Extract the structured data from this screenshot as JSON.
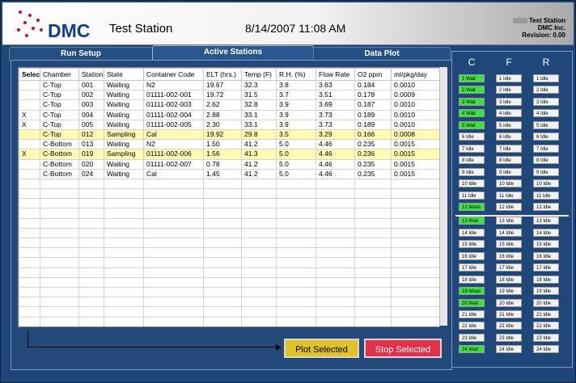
{
  "header": {
    "logo_text": "DMC",
    "app_title": "Test Station",
    "datetime": "8/14/2007   11:08 AM",
    "info_lines": [
      "Test Station",
      "DMC Inc.",
      "Revision: 0.00"
    ]
  },
  "tabs": [
    {
      "label": "Run Setup",
      "active": false
    },
    {
      "label": "Active Stations",
      "active": true
    },
    {
      "label": "Data Plot",
      "active": false
    }
  ],
  "table": {
    "columns": [
      "Select",
      "Chamber",
      "Station",
      "State",
      "Container Code",
      "ELT (hrs.)",
      "Temp (F)",
      "R.H. (%)",
      "Flow Rate",
      "O2 ppm",
      "ml/pkg/day"
    ],
    "rows": [
      {
        "cells": [
          "",
          "C-Top",
          "001",
          "Waiting",
          "N2",
          "19.67",
          "32.3",
          "3.8",
          "3.63",
          "0.184",
          "0.0010"
        ],
        "highlight": false
      },
      {
        "cells": [
          "",
          "C-Top",
          "002",
          "Waiting",
          "01111-002-001",
          "19.72",
          "31.5",
          "3.7",
          "3.51",
          "0.178",
          "0.0009"
        ],
        "highlight": false
      },
      {
        "cells": [
          "",
          "C-Top",
          "003",
          "Waiting",
          "01111-002-003",
          "2.62",
          "32.8",
          "3.9",
          "3.69",
          "0.187",
          "0.0010"
        ],
        "highlight": false
      },
      {
        "cells": [
          "X",
          "C-Top",
          "004",
          "Waiting",
          "01111-002-004",
          "2.88",
          "33.1",
          "3.9",
          "3.73",
          "0.189",
          "0.0010"
        ],
        "highlight": false
      },
      {
        "cells": [
          "X",
          "C-Top",
          "005",
          "Waiting",
          "01111-002-005",
          "2.30",
          "33.1",
          "3.9",
          "3.73",
          "0.189",
          "0.0010"
        ],
        "highlight": false
      },
      {
        "cells": [
          "",
          "C-Top",
          "012",
          "Sampling",
          "Cal",
          "19.92",
          "29.8",
          "3.5",
          "3.29",
          "0.166",
          "0.0008"
        ],
        "highlight": true
      },
      {
        "cells": [
          "",
          "C-Bottom",
          "013",
          "Waiting",
          "N2",
          "1.50",
          "41.2",
          "5.0",
          "4.46",
          "0.235",
          "0.0015"
        ],
        "highlight": false
      },
      {
        "cells": [
          "X",
          "C-Bottom",
          "019",
          "Sampling",
          "01111-002-006",
          "1.56",
          "41.3",
          "5.0",
          "4.46",
          "0.236",
          "0.0015"
        ],
        "highlight": true
      },
      {
        "cells": [
          "",
          "C-Bottom",
          "020",
          "Waiting",
          "01111-002-007",
          "0.78",
          "41.2",
          "5.0",
          "4.46",
          "0.235",
          "0.0015"
        ],
        "highlight": false
      },
      {
        "cells": [
          "",
          "C-Bottom",
          "024",
          "Waiting",
          "Cal",
          "1.45",
          "41.2",
          "5.0",
          "4.46",
          "0.235",
          "0.0015"
        ],
        "highlight": false
      }
    ],
    "empty_row_count": 17
  },
  "buttons": {
    "plot_selected": "Plot Selected",
    "stop_selected": "Stop Selected"
  },
  "status_panel": {
    "columns": [
      {
        "label": "C",
        "cells": [
          {
            "text": "1  Wait",
            "state": "wait"
          },
          {
            "text": "2  Wait",
            "state": "wait"
          },
          {
            "text": "3  Wait",
            "state": "wait"
          },
          {
            "text": "4  Wait",
            "state": "wait"
          },
          {
            "text": "5  Wait",
            "state": "wait"
          },
          {
            "text": "6  Idle",
            "state": "idle"
          },
          {
            "text": "7  Idle",
            "state": "idle"
          },
          {
            "text": "8  Idle",
            "state": "idle"
          },
          {
            "text": "9  Idle",
            "state": "idle"
          },
          {
            "text": "10  Idle",
            "state": "idle"
          },
          {
            "text": "11  Idle",
            "state": "idle"
          },
          {
            "text": "12  Meas",
            "state": "meas"
          },
          {
            "text": "13  Wait",
            "state": "wait"
          },
          {
            "text": "14  Idle",
            "state": "idle"
          },
          {
            "text": "15  Idle",
            "state": "idle"
          },
          {
            "text": "16  Idle",
            "state": "idle"
          },
          {
            "text": "17  Idle",
            "state": "idle"
          },
          {
            "text": "18  Idle",
            "state": "idle"
          },
          {
            "text": "19  Meas",
            "state": "meas"
          },
          {
            "text": "20  Wait",
            "state": "wait"
          },
          {
            "text": "21  Idle",
            "state": "idle"
          },
          {
            "text": "22  Idle",
            "state": "idle"
          },
          {
            "text": "23  Idle",
            "state": "idle"
          },
          {
            "text": "24  Wait",
            "state": "wait"
          }
        ]
      },
      {
        "label": "F",
        "cells": [
          {
            "text": "1  Idle",
            "state": "idle"
          },
          {
            "text": "2  Idle",
            "state": "idle"
          },
          {
            "text": "3  Idle",
            "state": "idle"
          },
          {
            "text": "4  Idle",
            "state": "idle"
          },
          {
            "text": "5  Idle",
            "state": "idle"
          },
          {
            "text": "6  Idle",
            "state": "idle"
          },
          {
            "text": "7  Idle",
            "state": "idle"
          },
          {
            "text": "8  Idle",
            "state": "idle"
          },
          {
            "text": "9  Idle",
            "state": "idle"
          },
          {
            "text": "10  Idle",
            "state": "idle"
          },
          {
            "text": "11  Idle",
            "state": "idle"
          },
          {
            "text": "12  Idle",
            "state": "idle"
          },
          {
            "text": "13  Idle",
            "state": "idle"
          },
          {
            "text": "14  Idle",
            "state": "idle"
          },
          {
            "text": "15  Idle",
            "state": "idle"
          },
          {
            "text": "16  Idle",
            "state": "idle"
          },
          {
            "text": "17  Idle",
            "state": "idle"
          },
          {
            "text": "18  Idle",
            "state": "idle"
          },
          {
            "text": "19  Idle",
            "state": "idle"
          },
          {
            "text": "20  Idle",
            "state": "idle"
          },
          {
            "text": "21  Idle",
            "state": "idle"
          },
          {
            "text": "22  Idle",
            "state": "idle"
          },
          {
            "text": "23  Idle",
            "state": "idle"
          },
          {
            "text": "24  Idle",
            "state": "idle"
          }
        ]
      },
      {
        "label": "R",
        "cells": [
          {
            "text": "1  Idle",
            "state": "idle"
          },
          {
            "text": "2  Idle",
            "state": "idle"
          },
          {
            "text": "3  Idle",
            "state": "idle"
          },
          {
            "text": "4  Idle",
            "state": "idle"
          },
          {
            "text": "5  Idle",
            "state": "idle"
          },
          {
            "text": "6  Idle",
            "state": "idle"
          },
          {
            "text": "7  Idle",
            "state": "idle"
          },
          {
            "text": "8  Idle",
            "state": "idle"
          },
          {
            "text": "9  Idle",
            "state": "idle"
          },
          {
            "text": "10  Idle",
            "state": "idle"
          },
          {
            "text": "11  Idle",
            "state": "idle"
          },
          {
            "text": "12  Idle",
            "state": "idle"
          },
          {
            "text": "13  Idle",
            "state": "idle"
          },
          {
            "text": "14  Idle",
            "state": "idle"
          },
          {
            "text": "15  Idle",
            "state": "idle"
          },
          {
            "text": "16  Idle",
            "state": "idle"
          },
          {
            "text": "17  Idle",
            "state": "idle"
          },
          {
            "text": "18  Idle",
            "state": "idle"
          },
          {
            "text": "19  Idle",
            "state": "idle"
          },
          {
            "text": "20  Idle",
            "state": "idle"
          },
          {
            "text": "21  Idle",
            "state": "idle"
          },
          {
            "text": "22  Idle",
            "state": "idle"
          },
          {
            "text": "23  Idle",
            "state": "idle"
          },
          {
            "text": "24  Idle",
            "state": "idle"
          }
        ]
      }
    ]
  },
  "colors": {
    "highlight_row": "#fffbb0",
    "active_green": "#3ee13e",
    "plot_button": "#e0c321",
    "stop_button": "#e4314a",
    "brand_blue": "#123f8c",
    "brand_red": "#c8102e"
  }
}
